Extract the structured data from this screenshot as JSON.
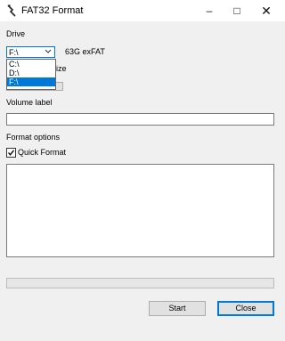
{
  "window": {
    "title": "FAT32 Format",
    "app_icon": "fat32-format-icon",
    "controls": {
      "minimize": "–",
      "maximize": "□",
      "close": "✕"
    }
  },
  "drive": {
    "section_label": "Drive",
    "selected": "F:\\",
    "info": "63G exFAT",
    "dropdown_open": true,
    "options": [
      "C:\\",
      "D:\\",
      "F:\\"
    ],
    "selected_index": 2,
    "obscured_label_fragment": "ize"
  },
  "volume": {
    "label": "Volume label",
    "value": ""
  },
  "format_options": {
    "label": "Format options",
    "quick_format_label": "Quick Format",
    "quick_format_checked": true
  },
  "log": {
    "text": ""
  },
  "progress": {
    "value": 0
  },
  "buttons": {
    "start": "Start",
    "close": "Close"
  },
  "colors": {
    "accent": "#0078d7",
    "background": "#f0f0f0"
  }
}
